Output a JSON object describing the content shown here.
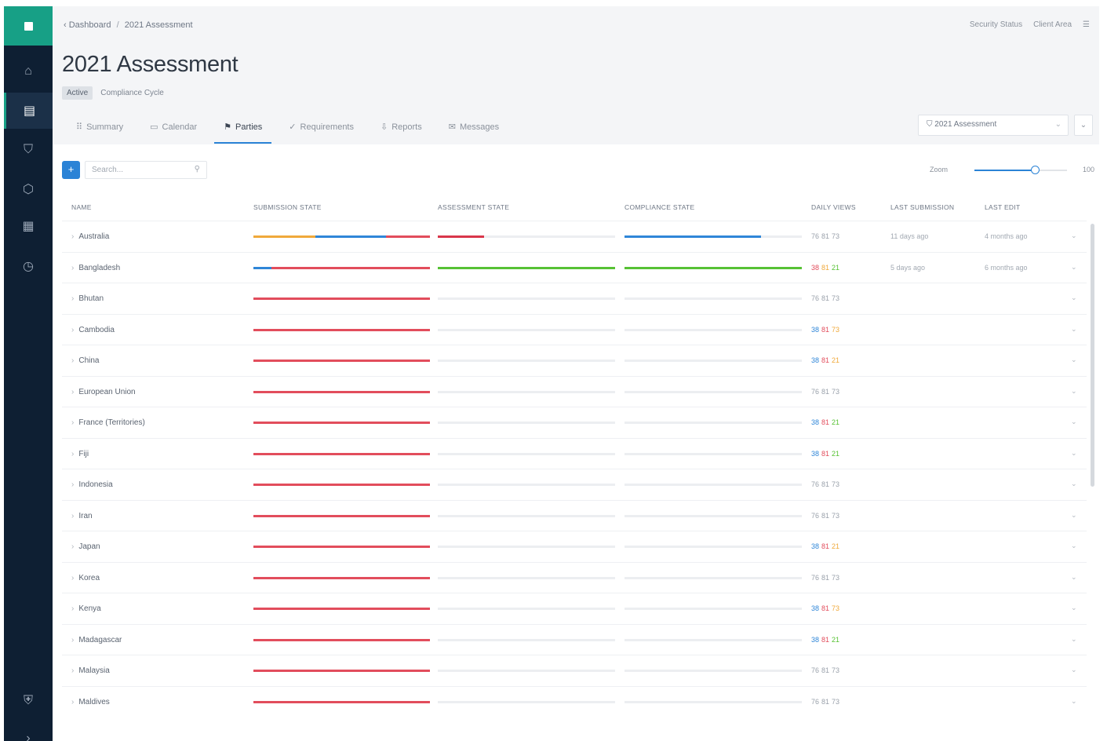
{
  "sidebar": {
    "logo_icon": "square-logo-icon",
    "items": [
      {
        "icon": "home-icon",
        "glyph": "⌂"
      },
      {
        "icon": "dashboard-icon",
        "glyph": "▤"
      },
      {
        "icon": "shield-icon",
        "glyph": "⛉"
      },
      {
        "icon": "cube-icon",
        "glyph": "⬡"
      },
      {
        "icon": "building-icon",
        "glyph": "▦"
      },
      {
        "icon": "clock-icon",
        "glyph": "◷"
      }
    ],
    "bottom_items": [
      {
        "icon": "shield-check-icon",
        "glyph": "⛨"
      },
      {
        "icon": "chevron-right-icon",
        "glyph": "›"
      }
    ]
  },
  "header": {
    "breadcrumb": [
      "Dashboard",
      "2021 Assessment"
    ],
    "right_links": [
      "Security Status",
      "Client Area"
    ],
    "title": "2021 Assessment",
    "badge": "Active",
    "badge_text": "Compliance Cycle"
  },
  "tabs": [
    {
      "label": "Summary",
      "glyph": "⠿"
    },
    {
      "label": "Calendar",
      "glyph": "▭"
    },
    {
      "label": "Parties",
      "glyph": "⚑",
      "active": true
    },
    {
      "label": "Requirements",
      "glyph": "✓"
    },
    {
      "label": "Reports",
      "glyph": "⇩"
    },
    {
      "label": "Messages",
      "glyph": "✉"
    }
  ],
  "assessment_select": {
    "value": "2021 Assessment"
  },
  "toolbar": {
    "add_label": "+",
    "search_placeholder": "Search...",
    "zoom_label": "Zoom",
    "zoom_value": "100",
    "zoom_level": 0.65
  },
  "table": {
    "headers": [
      "NAME",
      "SUBMISSION STATE",
      "ASSESSMENT STATE",
      "COMPLIANCE STATE",
      "DAILY VIEWS",
      "LAST SUBMISSION",
      "LAST EDIT"
    ],
    "rows": [
      {
        "name": "Australia",
        "submission": [
          [
            "#f0a93b",
            0.35
          ],
          [
            "#2f86d8",
            0.4
          ],
          [
            "#e24d5c",
            0.25
          ]
        ],
        "assessment": [
          [
            "#d9364a",
            0.26
          ]
        ],
        "compliance": [
          [
            "#2f86d8",
            0.77
          ]
        ],
        "scores": [
          {
            "v": "76",
            "c": "#9aa1ab"
          },
          {
            "v": "81",
            "c": "#9aa1ab"
          },
          {
            "v": "73",
            "c": "#9aa1ab"
          }
        ],
        "last_submission": "11 days ago",
        "last_edit": "4 months ago"
      },
      {
        "name": "Bangladesh",
        "submission": [
          [
            "#2f86d8",
            0.1
          ],
          [
            "#e24d5c",
            0.9
          ]
        ],
        "assessment": [
          [
            "#57c234",
            1.0
          ]
        ],
        "compliance": [
          [
            "#57c234",
            1.0
          ]
        ],
        "scores": [
          {
            "v": "38",
            "c": "#e24d5c"
          },
          {
            "v": "81",
            "c": "#f0a93b"
          },
          {
            "v": "21",
            "c": "#57c234"
          }
        ],
        "last_submission": "5 days ago",
        "last_edit": "6 months ago"
      },
      {
        "name": "Bhutan",
        "submission": [
          [
            "#e24d5c",
            1.0
          ]
        ],
        "assessment": [],
        "compliance": [],
        "scores": [
          {
            "v": "76",
            "c": "#9aa1ab"
          },
          {
            "v": "81",
            "c": "#9aa1ab"
          },
          {
            "v": "73",
            "c": "#9aa1ab"
          }
        ],
        "last_submission": "",
        "last_edit": ""
      },
      {
        "name": "Cambodia",
        "submission": [
          [
            "#e24d5c",
            1.0
          ]
        ],
        "assessment": [],
        "compliance": [],
        "scores": [
          {
            "v": "38",
            "c": "#2f86d8"
          },
          {
            "v": "81",
            "c": "#e24d5c"
          },
          {
            "v": "73",
            "c": "#f0a93b"
          }
        ],
        "last_submission": "",
        "last_edit": ""
      },
      {
        "name": "China",
        "submission": [
          [
            "#e24d5c",
            1.0
          ]
        ],
        "assessment": [],
        "compliance": [],
        "scores": [
          {
            "v": "38",
            "c": "#2f86d8"
          },
          {
            "v": "81",
            "c": "#e24d5c"
          },
          {
            "v": "21",
            "c": "#f0a93b"
          }
        ],
        "last_submission": "",
        "last_edit": ""
      },
      {
        "name": "European Union",
        "submission": [
          [
            "#e24d5c",
            1.0
          ]
        ],
        "assessment": [],
        "compliance": [],
        "scores": [
          {
            "v": "76",
            "c": "#9aa1ab"
          },
          {
            "v": "81",
            "c": "#9aa1ab"
          },
          {
            "v": "73",
            "c": "#9aa1ab"
          }
        ],
        "last_submission": "",
        "last_edit": ""
      },
      {
        "name": "France (Territories)",
        "submission": [
          [
            "#e24d5c",
            1.0
          ]
        ],
        "assessment": [],
        "compliance": [],
        "scores": [
          {
            "v": "38",
            "c": "#2f86d8"
          },
          {
            "v": "81",
            "c": "#e24d5c"
          },
          {
            "v": "21",
            "c": "#57c234"
          }
        ],
        "last_submission": "",
        "last_edit": ""
      },
      {
        "name": "Fiji",
        "submission": [
          [
            "#e24d5c",
            1.0
          ]
        ],
        "assessment": [],
        "compliance": [],
        "scores": [
          {
            "v": "38",
            "c": "#2f86d8"
          },
          {
            "v": "81",
            "c": "#e24d5c"
          },
          {
            "v": "21",
            "c": "#57c234"
          }
        ],
        "last_submission": "",
        "last_edit": ""
      },
      {
        "name": "Indonesia",
        "submission": [
          [
            "#e24d5c",
            1.0
          ]
        ],
        "assessment": [],
        "compliance": [],
        "scores": [
          {
            "v": "76",
            "c": "#9aa1ab"
          },
          {
            "v": "81",
            "c": "#9aa1ab"
          },
          {
            "v": "73",
            "c": "#9aa1ab"
          }
        ],
        "last_submission": "",
        "last_edit": ""
      },
      {
        "name": "Iran",
        "submission": [
          [
            "#e24d5c",
            1.0
          ]
        ],
        "assessment": [],
        "compliance": [],
        "scores": [
          {
            "v": "76",
            "c": "#9aa1ab"
          },
          {
            "v": "81",
            "c": "#9aa1ab"
          },
          {
            "v": "73",
            "c": "#9aa1ab"
          }
        ],
        "last_submission": "",
        "last_edit": ""
      },
      {
        "name": "Japan",
        "submission": [
          [
            "#e24d5c",
            1.0
          ]
        ],
        "assessment": [],
        "compliance": [],
        "scores": [
          {
            "v": "38",
            "c": "#2f86d8"
          },
          {
            "v": "81",
            "c": "#e24d5c"
          },
          {
            "v": "21",
            "c": "#f0a93b"
          }
        ],
        "last_submission": "",
        "last_edit": ""
      },
      {
        "name": "Korea",
        "submission": [
          [
            "#e24d5c",
            1.0
          ]
        ],
        "assessment": [],
        "compliance": [],
        "scores": [
          {
            "v": "76",
            "c": "#9aa1ab"
          },
          {
            "v": "81",
            "c": "#9aa1ab"
          },
          {
            "v": "73",
            "c": "#9aa1ab"
          }
        ],
        "last_submission": "",
        "last_edit": ""
      },
      {
        "name": "Kenya",
        "submission": [
          [
            "#e24d5c",
            1.0
          ]
        ],
        "assessment": [],
        "compliance": [],
        "scores": [
          {
            "v": "38",
            "c": "#2f86d8"
          },
          {
            "v": "81",
            "c": "#e24d5c"
          },
          {
            "v": "73",
            "c": "#f0a93b"
          }
        ],
        "last_submission": "",
        "last_edit": ""
      },
      {
        "name": "Madagascar",
        "submission": [
          [
            "#e24d5c",
            1.0
          ]
        ],
        "assessment": [],
        "compliance": [],
        "scores": [
          {
            "v": "38",
            "c": "#2f86d8"
          },
          {
            "v": "81",
            "c": "#e24d5c"
          },
          {
            "v": "21",
            "c": "#57c234"
          }
        ],
        "last_submission": "",
        "last_edit": ""
      },
      {
        "name": "Malaysia",
        "submission": [
          [
            "#e24d5c",
            1.0
          ]
        ],
        "assessment": [],
        "compliance": [],
        "scores": [
          {
            "v": "76",
            "c": "#9aa1ab"
          },
          {
            "v": "81",
            "c": "#9aa1ab"
          },
          {
            "v": "73",
            "c": "#9aa1ab"
          }
        ],
        "last_submission": "",
        "last_edit": ""
      },
      {
        "name": "Maldives",
        "submission": [
          [
            "#e24d5c",
            1.0
          ]
        ],
        "assessment": [],
        "compliance": [],
        "scores": [
          {
            "v": "76",
            "c": "#9aa1ab"
          },
          {
            "v": "81",
            "c": "#9aa1ab"
          },
          {
            "v": "73",
            "c": "#9aa1ab"
          }
        ],
        "last_submission": "",
        "last_edit": ""
      }
    ]
  },
  "colors": {
    "accent": "#2b83d6",
    "brand": "#17a086",
    "sidebar": "#0e1f33",
    "red": "#e24d5c",
    "green": "#57c234",
    "orange": "#f0a93b",
    "blue": "#2f86d8"
  }
}
